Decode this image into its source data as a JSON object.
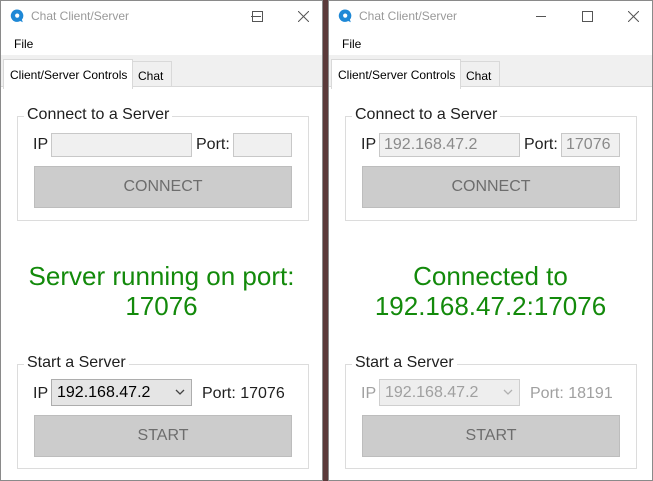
{
  "colors": {
    "status_green": "#138a0b",
    "button_gray": "#cccccc",
    "app_icon_blue": "#1e88d6"
  },
  "left": {
    "title": "Chat Client/Server",
    "menu": {
      "file": "File"
    },
    "tabs": [
      {
        "label": "Client/Server Controls",
        "active": true
      },
      {
        "label": "Chat",
        "active": false
      }
    ],
    "connect": {
      "legend": "Connect to a Server",
      "ip_label": "IP",
      "ip_value": "",
      "port_label": "Port:",
      "port_value": "",
      "button": "CONNECT"
    },
    "status_lines": [
      "Server running on port:",
      "17076"
    ],
    "start": {
      "legend": "Start a Server",
      "ip_label": "IP",
      "ip_selected": "192.168.47.2",
      "port_text": "Port: 17076",
      "button": "START"
    }
  },
  "right": {
    "title": "Chat Client/Server",
    "menu": {
      "file": "File"
    },
    "tabs": [
      {
        "label": "Client/Server Controls",
        "active": true
      },
      {
        "label": "Chat",
        "active": false
      }
    ],
    "connect": {
      "legend": "Connect to a Server",
      "ip_label": "IP",
      "ip_value": "192.168.47.2",
      "port_label": "Port:",
      "port_value": "17076",
      "button": "CONNECT"
    },
    "status_lines": [
      "Connected to",
      "192.168.47.2:17076"
    ],
    "start": {
      "legend": "Start a Server",
      "ip_label": "IP",
      "ip_selected": "192.168.47.2",
      "port_text": "Port: 18191",
      "button": "START"
    }
  }
}
